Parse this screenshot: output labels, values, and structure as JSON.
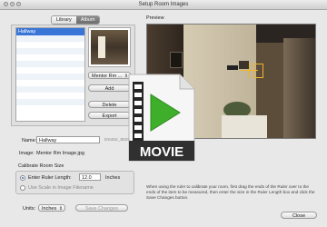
{
  "window": {
    "title": "Setup Room Images"
  },
  "tabs": {
    "library": "Library",
    "album": "Album"
  },
  "rooms": {
    "items": [
      "Hallway"
    ]
  },
  "room_popup": {
    "value": "Mentor Rm ..."
  },
  "buttons": {
    "add": "Add",
    "delete": "Delete",
    "export": "Export",
    "save": "Save Changes",
    "close": "Close"
  },
  "name": {
    "label": "Name:",
    "value": "Hallway",
    "id": "DS462_8528"
  },
  "image": {
    "label": "Image:",
    "value": "Mentor Rm Image.jpg"
  },
  "calibrate": {
    "label": "Calibrate Room Size",
    "ruler_label": "Enter Ruler Length:",
    "ruler_value": "12.0",
    "ruler_unit": "Inches",
    "scale_label": "Use Scale in Image Filename"
  },
  "units": {
    "label": "Units:",
    "value": "Inches"
  },
  "preview": {
    "label": "Preview",
    "instructions": "When using the ruler to calibrate your room, first drag the ends of the Ruler over to the ends of the item to be measured, then enter the size in the Ruler Length box and click the Save Changes button."
  },
  "overlay": {
    "text": "MOVIE"
  },
  "colors": {
    "selection": "#3875d7",
    "accent_green": "#3fae2a",
    "ruler_yellow": "#f0b52a"
  }
}
